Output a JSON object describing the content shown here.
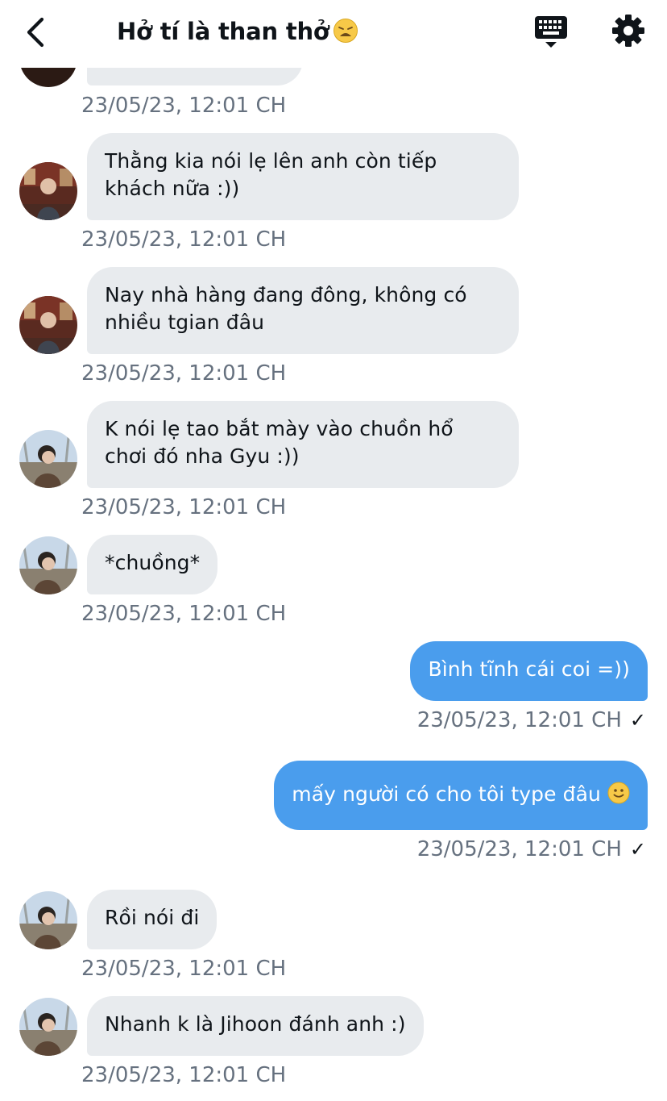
{
  "header": {
    "title": "Hở tí là than thở",
    "title_emoji": "weary-face-emoji",
    "back_icon": "chevron-left-icon",
    "keyboard_icon": "keyboard-icon",
    "settings_icon": "gear-icon"
  },
  "colors": {
    "incoming_bubble": "#e8ebee",
    "outgoing_bubble": "#4a9ded",
    "timestamp": "#66717f"
  },
  "messages": [
    {
      "id": "m0",
      "direction": "in",
      "text": "",
      "timestamp": "23/05/23, 12:01 CH"
    },
    {
      "id": "m1",
      "direction": "in",
      "text": "Thằng kia nói lẹ lên anh còn tiếp khách nữa :))",
      "timestamp": "23/05/23, 12:01 CH"
    },
    {
      "id": "m2",
      "direction": "in",
      "text": "Nay nhà hàng đang đông, không có nhiều tgian đâu",
      "timestamp": "23/05/23, 12:01 CH"
    },
    {
      "id": "m3",
      "direction": "in",
      "text": "K nói lẹ tao bắt mày vào chuồn hổ chơi đó nha Gyu :))",
      "timestamp": "23/05/23, 12:01 CH"
    },
    {
      "id": "m4",
      "direction": "in",
      "text": "*chuồng*",
      "timestamp": "23/05/23, 12:01 CH"
    },
    {
      "id": "m5",
      "direction": "out",
      "text": "Bình tĩnh cái coi =))",
      "timestamp": "23/05/23, 12:01 CH",
      "status": "✓"
    },
    {
      "id": "m6",
      "direction": "out",
      "text": "mấy người có cho tôi type đâu",
      "emoji": "slightly-smiling-face-emoji",
      "timestamp": "23/05/23, 12:01 CH",
      "status": "✓"
    },
    {
      "id": "m7",
      "direction": "in",
      "text": "Rồi nói đi",
      "timestamp": "23/05/23, 12:01 CH"
    },
    {
      "id": "m8",
      "direction": "in",
      "text": "Nhanh k là Jihoon đánh anh :)",
      "timestamp": "23/05/23, 12:01 CH"
    }
  ]
}
